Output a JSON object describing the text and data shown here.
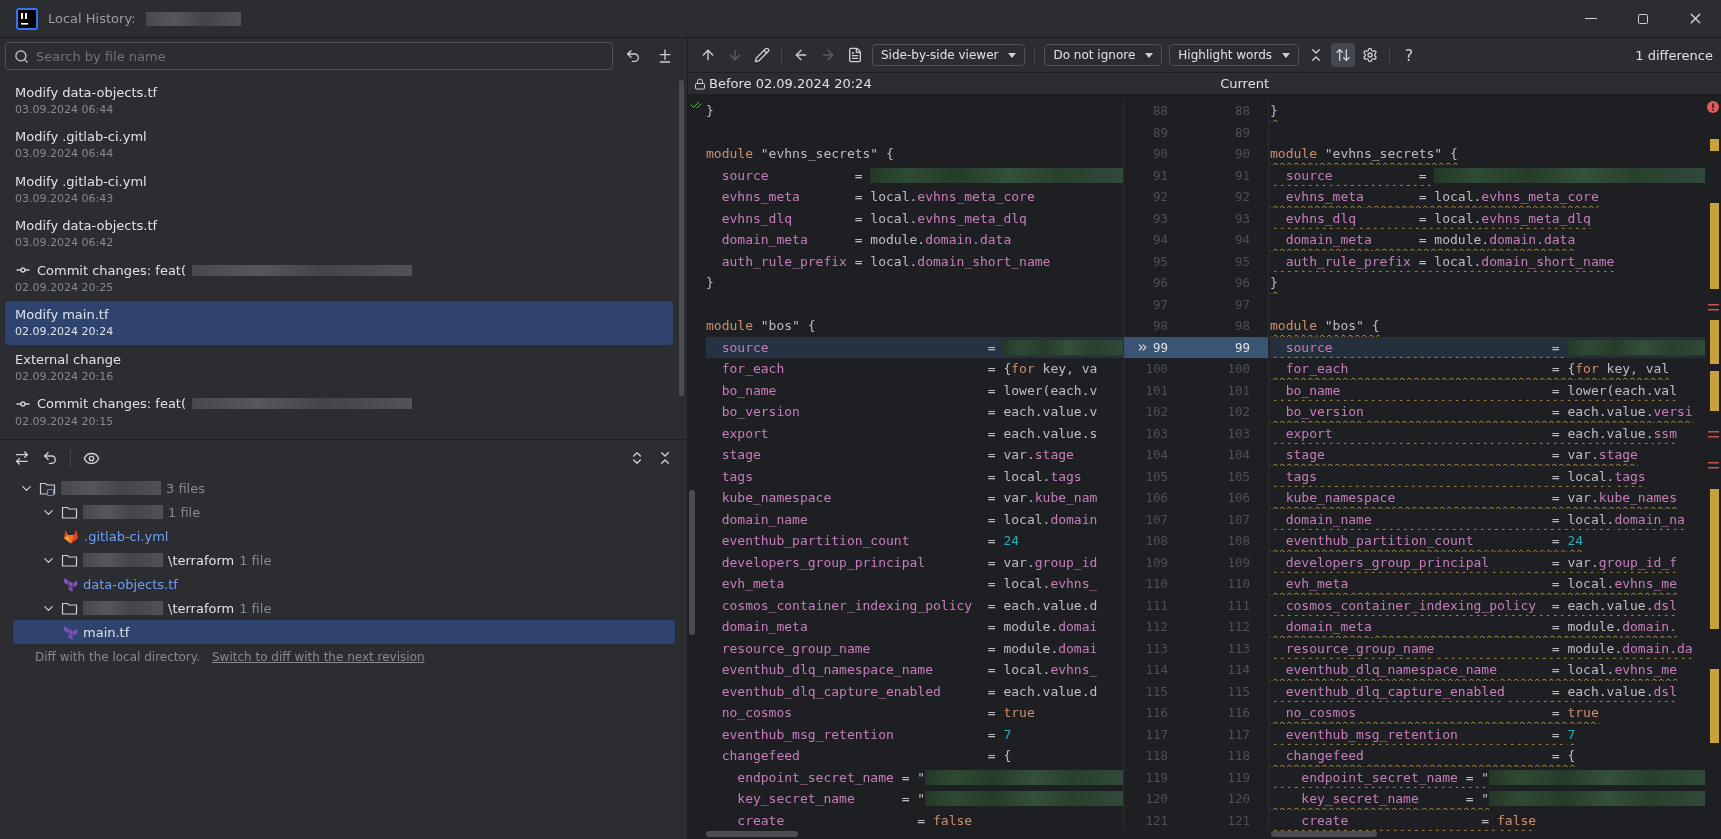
{
  "window": {
    "title": "Local History:"
  },
  "search": {
    "placeholder": "Search by file name"
  },
  "history": [
    {
      "title": "Modify data-objects.tf",
      "date": "03.09.2024 06:44",
      "kind": "change",
      "selected": false
    },
    {
      "title": "Modify .gitlab-ci.yml",
      "date": "03.09.2024 06:44",
      "kind": "change",
      "selected": false
    },
    {
      "title": "Modify .gitlab-ci.yml",
      "date": "03.09.2024 06:43",
      "kind": "change",
      "selected": false
    },
    {
      "title": "Modify data-objects.tf",
      "date": "03.09.2024 06:42",
      "kind": "change",
      "selected": false
    },
    {
      "title": "Commit changes: feat(",
      "date": "02.09.2024 20:25",
      "kind": "commit",
      "selected": false
    },
    {
      "title": "Modify main.tf",
      "date": "02.09.2024 20:24",
      "kind": "change",
      "selected": true
    },
    {
      "title": "External change",
      "date": "02.09.2024 20:16",
      "kind": "change",
      "selected": false
    },
    {
      "title": "Commit changes: feat(",
      "date": "02.09.2024 20:15",
      "kind": "commit",
      "selected": false
    }
  ],
  "changes_tree": {
    "root": {
      "kind": "module",
      "count": "3 files",
      "expanded": true,
      "selected": false,
      "children": [
        {
          "kind": "folder",
          "count": "1 file",
          "expanded": true,
          "selected": false,
          "children": [
            {
              "kind": "yaml",
              "name": ".gitlab-ci.yml",
              "selected": false
            }
          ]
        },
        {
          "kind": "folder",
          "name": "\\terraform",
          "count": "1 file",
          "expanded": true,
          "selected": false,
          "children": [
            {
              "kind": "terraform",
              "name": "data-objects.tf",
              "selected": false
            }
          ]
        },
        {
          "kind": "folder",
          "name": "\\terraform",
          "count": "1 file",
          "expanded": true,
          "selected": false,
          "children": [
            {
              "kind": "terraform",
              "name": "main.tf",
              "selected": true
            }
          ]
        }
      ]
    }
  },
  "footer": {
    "note": "Diff with the local directory.",
    "link": "Switch to diff with the next revision"
  },
  "toolbar": {
    "items": [
      {
        "kind": "up",
        "disabled": false
      },
      {
        "kind": "down",
        "disabled": true
      },
      {
        "kind": "edit",
        "disabled": false
      },
      {
        "kind": "separator"
      },
      {
        "kind": "back",
        "disabled": false
      },
      {
        "kind": "forward",
        "disabled": true
      },
      {
        "kind": "document",
        "disabled": false
      },
      {
        "kind": "dropdown",
        "label": "Side-by-side viewer"
      },
      {
        "kind": "separator"
      },
      {
        "kind": "dropdown",
        "label": "Do not ignore"
      },
      {
        "kind": "dropdown",
        "label": "Highlight words"
      },
      {
        "kind": "collapse",
        "disabled": false
      },
      {
        "kind": "sync",
        "selected": true
      },
      {
        "kind": "settings",
        "disabled": false
      },
      {
        "kind": "separator"
      },
      {
        "kind": "help",
        "label": "?"
      }
    ],
    "difference_count": "1 difference"
  },
  "diff": {
    "before_label": "Before 02.09.2024 20:24",
    "current_label": "Current"
  },
  "code_lines": [
    {
      "number_before": "88",
      "number_current": "88",
      "selected": false,
      "changed": true,
      "before": [
        {
          "kind": "plain",
          "text": "}"
        }
      ],
      "current": [
        {
          "kind": "plain",
          "text": "}"
        }
      ]
    },
    {
      "number_before": "89",
      "number_current": "89",
      "selected": false,
      "changed": false
    },
    {
      "number_before": "90",
      "number_current": "90",
      "selected": false,
      "changed": true,
      "before": [
        {
          "kind": "kw",
          "text": "module"
        },
        {
          "kind": "plain",
          "text": " \"evhns_secrets\" {"
        }
      ],
      "current": [
        {
          "kind": "kw",
          "text": "module"
        },
        {
          "kind": "plain",
          "text": " \"evhns_secrets\" {"
        }
      ]
    },
    {
      "number_before": "91",
      "number_current": "91",
      "selected": false,
      "changed": true,
      "before": [
        {
          "kind": "prop",
          "text": "  source"
        },
        {
          "kind": "plain",
          "text": "           = "
        }
      ],
      "before_redacted": true,
      "current": [
        {
          "kind": "prop",
          "text": "  source"
        },
        {
          "kind": "plain",
          "text": "           = "
        }
      ],
      "current_redacted": true
    },
    {
      "number_before": "92",
      "number_current": "92",
      "selected": false,
      "changed": true,
      "before": [
        {
          "kind": "prop",
          "text": "  evhns_meta"
        },
        {
          "kind": "plain",
          "text": "       = local."
        },
        {
          "kind": "member",
          "text": "evhns_meta_core"
        }
      ],
      "current": [
        {
          "kind": "prop",
          "text": "  evhns_meta"
        },
        {
          "kind": "plain",
          "text": "       = local."
        },
        {
          "kind": "member",
          "text": "evhns_meta_core"
        }
      ]
    },
    {
      "number_before": "93",
      "number_current": "93",
      "selected": false,
      "changed": true,
      "before": [
        {
          "kind": "prop",
          "text": "  evhns_dlq"
        },
        {
          "kind": "plain",
          "text": "        = local."
        },
        {
          "kind": "member",
          "text": "evhns_meta_dlq"
        }
      ],
      "current": [
        {
          "kind": "prop",
          "text": "  evhns_dlq"
        },
        {
          "kind": "plain",
          "text": "        = local."
        },
        {
          "kind": "member",
          "text": "evhns_meta_dlq"
        }
      ]
    },
    {
      "number_before": "94",
      "number_current": "94",
      "selected": false,
      "changed": true,
      "before": [
        {
          "kind": "prop",
          "text": "  domain_meta"
        },
        {
          "kind": "plain",
          "text": "      = module."
        },
        {
          "kind": "member",
          "text": "domain.data"
        }
      ],
      "current": [
        {
          "kind": "prop",
          "text": "  domain_meta"
        },
        {
          "kind": "plain",
          "text": "      = module."
        },
        {
          "kind": "member",
          "text": "domain.data"
        }
      ]
    },
    {
      "number_before": "95",
      "number_current": "95",
      "selected": false,
      "changed": true,
      "before": [
        {
          "kind": "prop",
          "text": "  auth_rule_prefix"
        },
        {
          "kind": "plain",
          "text": " = local."
        },
        {
          "kind": "member",
          "text": "domain_short_name"
        }
      ],
      "current": [
        {
          "kind": "prop",
          "text": "  auth_rule_prefix"
        },
        {
          "kind": "plain",
          "text": " = local."
        },
        {
          "kind": "member",
          "text": "domain_short_name"
        }
      ]
    },
    {
      "number_before": "96",
      "number_current": "96",
      "selected": false,
      "changed": true,
      "before": [
        {
          "kind": "plain",
          "text": "}"
        }
      ],
      "current": [
        {
          "kind": "plain",
          "text": "}"
        }
      ]
    },
    {
      "number_before": "97",
      "number_current": "97",
      "selected": false,
      "changed": false
    },
    {
      "number_before": "98",
      "number_current": "98",
      "selected": false,
      "changed": true,
      "before": [
        {
          "kind": "kw",
          "text": "module"
        },
        {
          "kind": "plain",
          "text": " \"bos\" {"
        }
      ],
      "current": [
        {
          "kind": "kw",
          "text": "module"
        },
        {
          "kind": "plain",
          "text": " \"bos\" {"
        }
      ]
    },
    {
      "number_before": "99",
      "number_current": "99",
      "selected": true,
      "changed": true,
      "before": [
        {
          "kind": "prop",
          "text": "  source"
        },
        {
          "kind": "plain",
          "text": "                            = "
        }
      ],
      "before_redacted": true,
      "current": [
        {
          "kind": "prop",
          "text": "  source"
        },
        {
          "kind": "plain",
          "text": "                            = "
        }
      ],
      "current_redacted": true
    },
    {
      "number_before": "100",
      "number_current": "100",
      "selected": false,
      "changed": true,
      "before": [
        {
          "kind": "prop",
          "text": "  for_each"
        },
        {
          "kind": "plain",
          "text": "                          = {"
        },
        {
          "kind": "kw",
          "text": "for"
        },
        {
          "kind": "plain",
          "text": " key, va"
        }
      ],
      "current": [
        {
          "kind": "prop",
          "text": "  for_each"
        },
        {
          "kind": "plain",
          "text": "                          = {"
        },
        {
          "kind": "kw",
          "text": "for"
        },
        {
          "kind": "plain",
          "text": " key, val"
        }
      ]
    },
    {
      "number_before": "101",
      "number_current": "101",
      "selected": false,
      "changed": true,
      "before": [
        {
          "kind": "prop",
          "text": "  bo_name"
        },
        {
          "kind": "plain",
          "text": "                           = lower(each.v"
        }
      ],
      "current": [
        {
          "kind": "prop",
          "text": "  bo_name"
        },
        {
          "kind": "plain",
          "text": "                           = lower(each.val"
        }
      ]
    },
    {
      "number_before": "102",
      "number_current": "102",
      "selected": false,
      "changed": true,
      "before": [
        {
          "kind": "prop",
          "text": "  bo_version"
        },
        {
          "kind": "plain",
          "text": "                        = each.value.v"
        }
      ],
      "current": [
        {
          "kind": "prop",
          "text": "  bo_version"
        },
        {
          "kind": "plain",
          "text": "                        = each.value."
        },
        {
          "kind": "member",
          "text": "versi"
        }
      ]
    },
    {
      "number_before": "103",
      "number_current": "103",
      "selected": false,
      "changed": true,
      "before": [
        {
          "kind": "prop",
          "text": "  export"
        },
        {
          "kind": "plain",
          "text": "                            = each.value.s"
        }
      ],
      "current": [
        {
          "kind": "prop",
          "text": "  export"
        },
        {
          "kind": "plain",
          "text": "                            = each.value."
        },
        {
          "kind": "member",
          "text": "ssm"
        }
      ]
    },
    {
      "number_before": "104",
      "number_current": "104",
      "selected": false,
      "changed": true,
      "before": [
        {
          "kind": "prop",
          "text": "  stage"
        },
        {
          "kind": "plain",
          "text": "                             = var."
        },
        {
          "kind": "member",
          "text": "stage"
        }
      ],
      "current": [
        {
          "kind": "prop",
          "text": "  stage"
        },
        {
          "kind": "plain",
          "text": "                             = var."
        },
        {
          "kind": "member",
          "text": "stage"
        }
      ]
    },
    {
      "number_before": "105",
      "number_current": "105",
      "selected": false,
      "changed": true,
      "before": [
        {
          "kind": "prop",
          "text": "  tags"
        },
        {
          "kind": "plain",
          "text": "                              = local."
        },
        {
          "kind": "member",
          "text": "tags"
        }
      ],
      "current": [
        {
          "kind": "prop",
          "text": "  tags"
        },
        {
          "kind": "plain",
          "text": "                              = local."
        },
        {
          "kind": "member",
          "text": "tags"
        }
      ]
    },
    {
      "number_before": "106",
      "number_current": "106",
      "selected": false,
      "changed": true,
      "before": [
        {
          "kind": "prop",
          "text": "  kube_namespace"
        },
        {
          "kind": "plain",
          "text": "                    = var."
        },
        {
          "kind": "member",
          "text": "kube_nam"
        }
      ],
      "current": [
        {
          "kind": "prop",
          "text": "  kube_namespace"
        },
        {
          "kind": "plain",
          "text": "                    = var."
        },
        {
          "kind": "member",
          "text": "kube_names"
        }
      ]
    },
    {
      "number_before": "107",
      "number_current": "107",
      "selected": false,
      "changed": true,
      "before": [
        {
          "kind": "prop",
          "text": "  domain_name"
        },
        {
          "kind": "plain",
          "text": "                       = local."
        },
        {
          "kind": "member",
          "text": "domain"
        }
      ],
      "current": [
        {
          "kind": "prop",
          "text": "  domain_name"
        },
        {
          "kind": "plain",
          "text": "                       = local."
        },
        {
          "kind": "member",
          "text": "domain_na"
        }
      ]
    },
    {
      "number_before": "108",
      "number_current": "108",
      "selected": false,
      "changed": true,
      "before": [
        {
          "kind": "prop",
          "text": "  eventhub_partition_count"
        },
        {
          "kind": "plain",
          "text": "          = "
        },
        {
          "kind": "num",
          "text": "24"
        }
      ],
      "current": [
        {
          "kind": "prop",
          "text": "  eventhub_partition_count"
        },
        {
          "kind": "plain",
          "text": "          = "
        },
        {
          "kind": "num",
          "text": "24"
        }
      ]
    },
    {
      "number_before": "109",
      "number_current": "109",
      "selected": false,
      "changed": true,
      "before": [
        {
          "kind": "prop",
          "text": "  developers_group_principal"
        },
        {
          "kind": "plain",
          "text": "        = var."
        },
        {
          "kind": "member",
          "text": "group_id"
        }
      ],
      "current": [
        {
          "kind": "prop",
          "text": "  developers_group_principal"
        },
        {
          "kind": "plain",
          "text": "        = var."
        },
        {
          "kind": "member",
          "text": "group_id_f"
        }
      ]
    },
    {
      "number_before": "110",
      "number_current": "110",
      "selected": false,
      "changed": true,
      "before": [
        {
          "kind": "prop",
          "text": "  evh_meta"
        },
        {
          "kind": "plain",
          "text": "                          = local."
        },
        {
          "kind": "member",
          "text": "evhns_"
        }
      ],
      "current": [
        {
          "kind": "prop",
          "text": "  evh_meta"
        },
        {
          "kind": "plain",
          "text": "                          = local."
        },
        {
          "kind": "member",
          "text": "evhns_me"
        }
      ]
    },
    {
      "number_before": "111",
      "number_current": "111",
      "selected": false,
      "changed": true,
      "before": [
        {
          "kind": "prop",
          "text": "  cosmos_container_indexing_policy"
        },
        {
          "kind": "plain",
          "text": "  = each.value.d"
        }
      ],
      "current": [
        {
          "kind": "prop",
          "text": "  cosmos_container_indexing_policy"
        },
        {
          "kind": "plain",
          "text": "  = each.value."
        },
        {
          "kind": "member",
          "text": "dsl"
        }
      ]
    },
    {
      "number_before": "112",
      "number_current": "112",
      "selected": false,
      "changed": true,
      "before": [
        {
          "kind": "prop",
          "text": "  domain_meta"
        },
        {
          "kind": "plain",
          "text": "                       = module."
        },
        {
          "kind": "member",
          "text": "domai"
        }
      ],
      "current": [
        {
          "kind": "prop",
          "text": "  domain_meta"
        },
        {
          "kind": "plain",
          "text": "                       = module."
        },
        {
          "kind": "member",
          "text": "domain."
        }
      ]
    },
    {
      "number_before": "113",
      "number_current": "113",
      "selected": false,
      "changed": true,
      "before": [
        {
          "kind": "prop",
          "text": "  resource_group_name"
        },
        {
          "kind": "plain",
          "text": "               = module."
        },
        {
          "kind": "member",
          "text": "domai"
        }
      ],
      "current": [
        {
          "kind": "prop",
          "text": "  resource_group_name"
        },
        {
          "kind": "plain",
          "text": "               = module."
        },
        {
          "kind": "member",
          "text": "domain.da"
        }
      ]
    },
    {
      "number_before": "114",
      "number_current": "114",
      "selected": false,
      "changed": true,
      "before": [
        {
          "kind": "prop",
          "text": "  eventhub_dlq_namespace_name"
        },
        {
          "kind": "plain",
          "text": "       = local."
        },
        {
          "kind": "member",
          "text": "evhns_"
        }
      ],
      "current": [
        {
          "kind": "prop",
          "text": "  eventhub_dlq_namespace_name"
        },
        {
          "kind": "plain",
          "text": "       = local."
        },
        {
          "kind": "member",
          "text": "evhns_me"
        }
      ]
    },
    {
      "number_before": "115",
      "number_current": "115",
      "selected": false,
      "changed": true,
      "before": [
        {
          "kind": "prop",
          "text": "  eventhub_dlq_capture_enabled"
        },
        {
          "kind": "plain",
          "text": "      = each.value.d"
        }
      ],
      "current": [
        {
          "kind": "prop",
          "text": "  eventhub_dlq_capture_enabled"
        },
        {
          "kind": "plain",
          "text": "      = each.value."
        },
        {
          "kind": "member",
          "text": "dsl"
        }
      ]
    },
    {
      "number_before": "116",
      "number_current": "116",
      "selected": false,
      "changed": true,
      "before": [
        {
          "kind": "prop",
          "text": "  no_cosmos"
        },
        {
          "kind": "plain",
          "text": "                         = "
        },
        {
          "kind": "kw",
          "text": "true"
        }
      ],
      "current": [
        {
          "kind": "prop",
          "text": "  no_cosmos"
        },
        {
          "kind": "plain",
          "text": "                         = "
        },
        {
          "kind": "kw",
          "text": "true"
        }
      ]
    },
    {
      "number_before": "117",
      "number_current": "117",
      "selected": false,
      "changed": true,
      "before": [
        {
          "kind": "prop",
          "text": "  eventhub_msg_retention"
        },
        {
          "kind": "plain",
          "text": "            = "
        },
        {
          "kind": "num",
          "text": "7"
        }
      ],
      "current": [
        {
          "kind": "prop",
          "text": "  eventhub_msg_retention"
        },
        {
          "kind": "plain",
          "text": "            = "
        },
        {
          "kind": "num",
          "text": "7"
        }
      ]
    },
    {
      "number_before": "118",
      "number_current": "118",
      "selected": false,
      "changed": true,
      "before": [
        {
          "kind": "prop",
          "text": "  changefeed"
        },
        {
          "kind": "plain",
          "text": "                        = {"
        }
      ],
      "current": [
        {
          "kind": "prop",
          "text": "  changefeed"
        },
        {
          "kind": "plain",
          "text": "                        = {"
        }
      ]
    },
    {
      "number_before": "119",
      "number_current": "119",
      "selected": false,
      "changed": true,
      "before": [
        {
          "kind": "prop",
          "text": "    endpoint_secret_name"
        },
        {
          "kind": "plain",
          "text": " = \""
        }
      ],
      "before_redacted": true,
      "current": [
        {
          "kind": "prop",
          "text": "    endpoint_secret_name"
        },
        {
          "kind": "plain",
          "text": " = \""
        }
      ],
      "current_redacted": true
    },
    {
      "number_before": "120",
      "number_current": "120",
      "selected": false,
      "changed": true,
      "before": [
        {
          "kind": "prop",
          "text": "    key_secret_name"
        },
        {
          "kind": "plain",
          "text": "      = \""
        }
      ],
      "before_redacted": true,
      "current": [
        {
          "kind": "prop",
          "text": "    key_secret_name"
        },
        {
          "kind": "plain",
          "text": "      = \""
        }
      ],
      "current_redacted": true
    },
    {
      "number_before": "121",
      "number_current": "121",
      "selected": false,
      "changed": true,
      "before": [
        {
          "kind": "prop",
          "text": "    create"
        },
        {
          "kind": "plain",
          "text": "                 = "
        },
        {
          "kind": "kw",
          "text": "false"
        }
      ],
      "current": [
        {
          "kind": "prop",
          "text": "    create"
        },
        {
          "kind": "plain",
          "text": "                 = "
        },
        {
          "kind": "kw",
          "text": "false"
        }
      ]
    }
  ]
}
